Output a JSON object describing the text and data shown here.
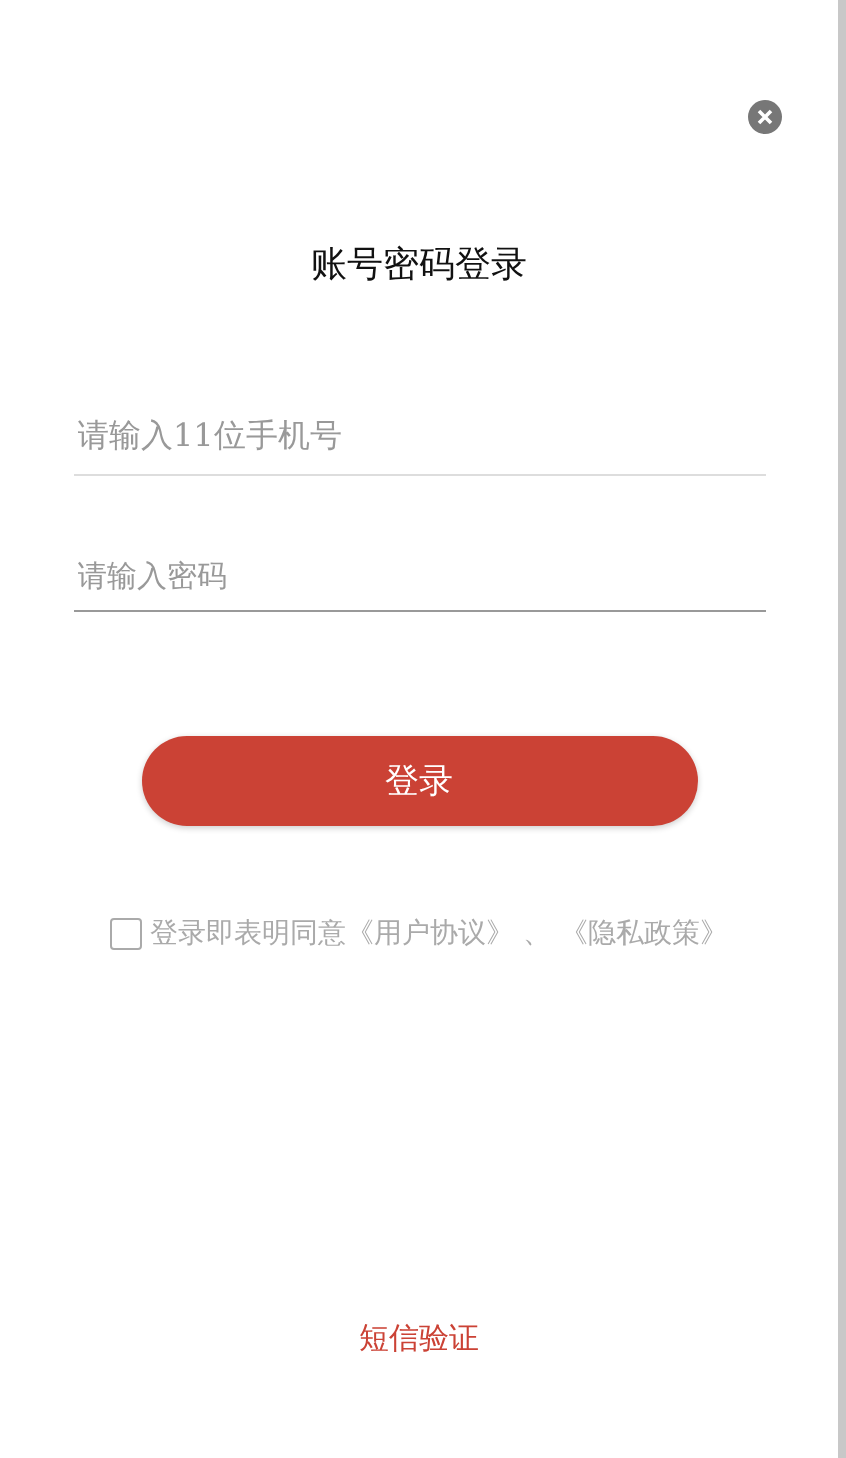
{
  "title": "账号密码登录",
  "phone_field": {
    "placeholder": "请输入11位手机号"
  },
  "password_field": {
    "placeholder": "请输入密码"
  },
  "login_button": "登录",
  "agreement": {
    "checked": false,
    "text": "登录即表明同意",
    "terms_link": "《用户协议》",
    "separator": "、",
    "privacy_link": "《隐私政策》"
  },
  "sms_link": "短信验证"
}
